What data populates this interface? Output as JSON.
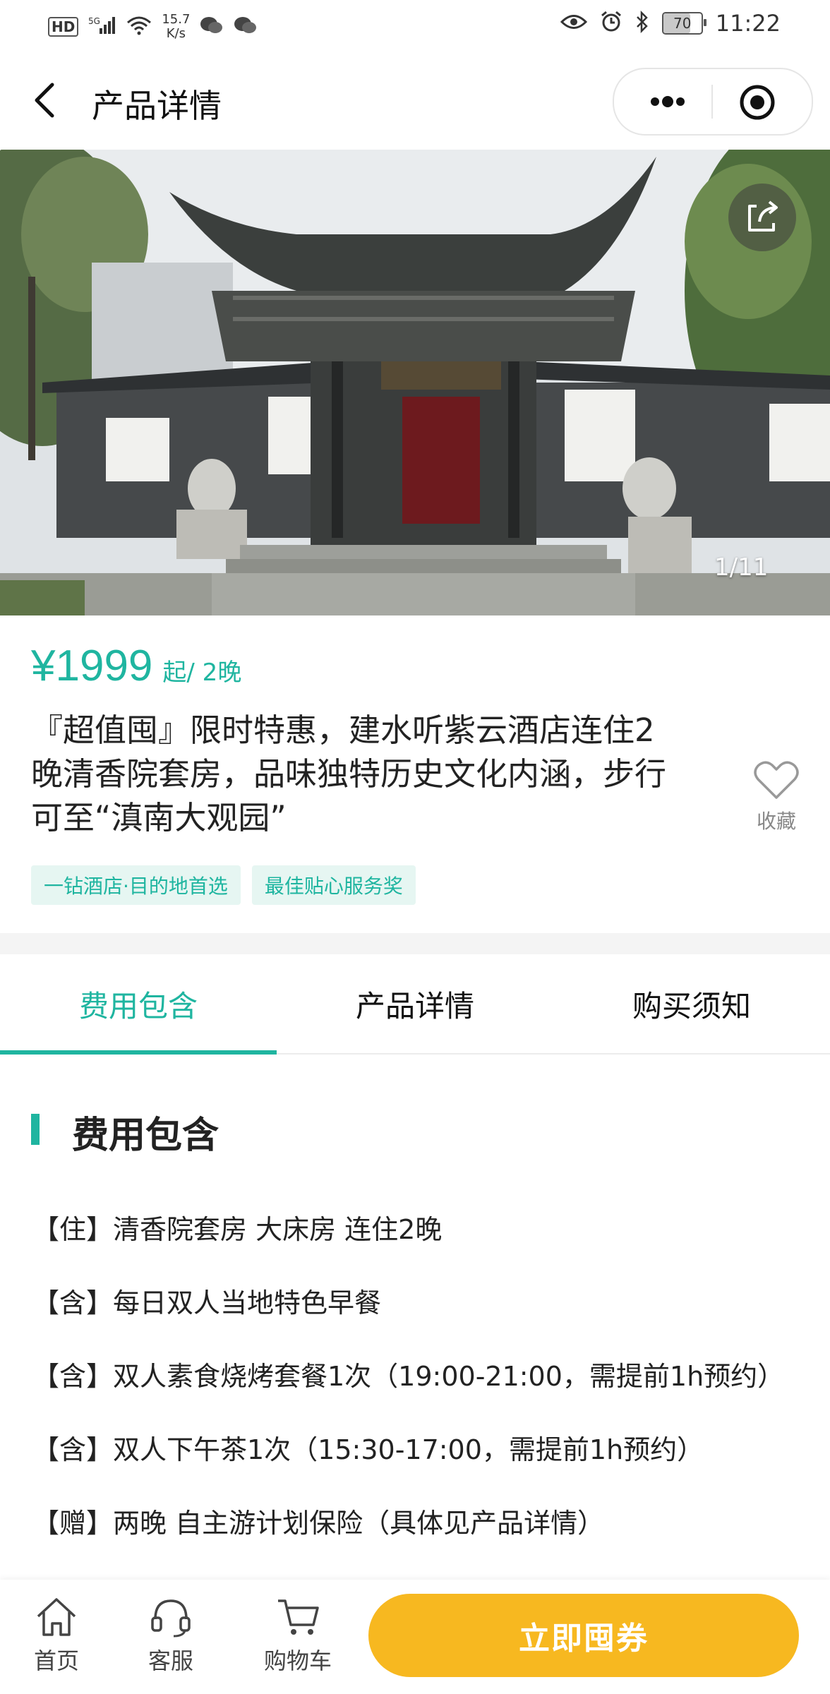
{
  "status_bar": {
    "network_label": "HD",
    "signal_label": "5G",
    "speed_value": "15.7",
    "speed_unit": "K/s",
    "battery": "70",
    "time": "11:22"
  },
  "nav": {
    "title": "产品详情"
  },
  "hero": {
    "counter": "1/11"
  },
  "product": {
    "price": "¥1999",
    "price_suffix": "起/ 2晚",
    "title": "『超值囤』限时特惠，建水听紫云酒店连住2晚清香院套房，品味独特历史文化内涵，步行可至“滇南大观园”",
    "favorite_label": "收藏",
    "tags": [
      "一钻酒店·目的地首选",
      "最佳贴心服务奖"
    ]
  },
  "tabs": [
    {
      "label": "费用包含",
      "active": true
    },
    {
      "label": "产品详情",
      "active": false
    },
    {
      "label": "购买须知",
      "active": false
    }
  ],
  "fee_section": {
    "title": "费用包含",
    "items": [
      "【住】清香院套房 大床房 连住2晚",
      "【含】每日双人当地特色早餐",
      "【含】双人素食烧烤套餐1次（19:00-21:00，需提前1h预约）",
      "【含】双人下午茶1次（15:30-17:00，需提前1h预约）",
      "【赠】两晚 自主游计划保险（具体见产品详情）"
    ]
  },
  "bottom_bar": {
    "home_label": "首页",
    "service_label": "客服",
    "cart_label": "购物车",
    "buy_label": "立即囤券"
  },
  "colors": {
    "accent": "#1fb5a0",
    "buy_button": "#f7b820",
    "tag_bg": "#e6f6f2"
  }
}
